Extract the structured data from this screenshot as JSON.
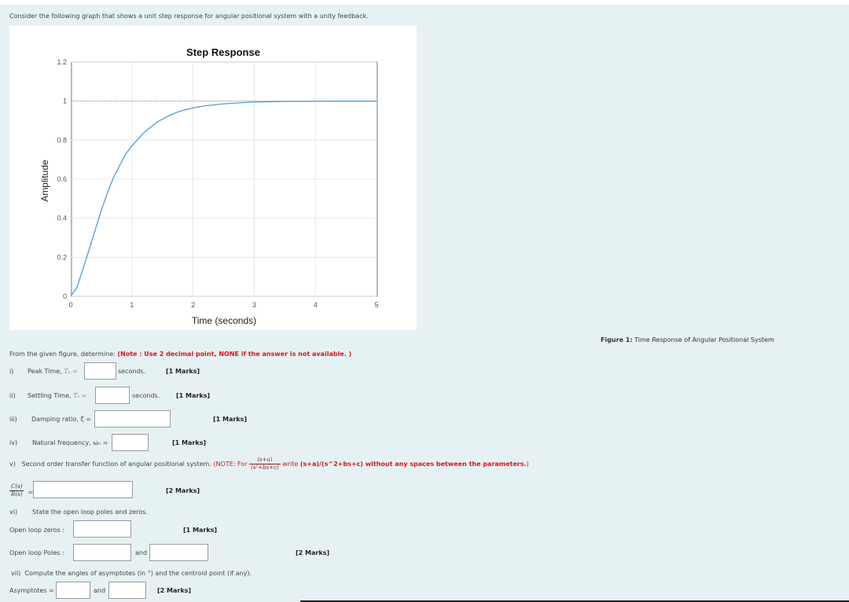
{
  "intro_text": "Consider the following graph that shows a unit step response for angular positional system with a unity feedback.",
  "chart_data": {
    "type": "line",
    "title": "Step Response",
    "xlabel": "Time (seconds)",
    "ylabel": "Amplitude",
    "xlim": [
      0,
      5
    ],
    "ylim": [
      0,
      1.2
    ],
    "x_ticks": [
      "0",
      "1",
      "2",
      "3",
      "4",
      "5"
    ],
    "y_ticks": [
      "0",
      "0.2",
      "0.4",
      "0.6",
      "0.8",
      "1",
      "1.2"
    ],
    "grid": true,
    "steady_state": 1,
    "series": [
      {
        "color": "#4f9bd9",
        "x": [
          0,
          0.1,
          0.2,
          0.3,
          0.4,
          0.5,
          0.6,
          0.7,
          0.8,
          0.9,
          1.0,
          1.2,
          1.4,
          1.6,
          1.8,
          2.0,
          2.2,
          2.5,
          2.8,
          3.0,
          3.5,
          4.0,
          4.5,
          5.0
        ],
        "y": [
          0,
          0.045,
          0.14,
          0.24,
          0.34,
          0.44,
          0.53,
          0.61,
          0.67,
          0.73,
          0.77,
          0.84,
          0.89,
          0.925,
          0.95,
          0.965,
          0.976,
          0.986,
          0.992,
          0.995,
          0.998,
          0.999,
          1.0,
          1.0
        ]
      }
    ]
  },
  "figure_caption": {
    "label": "Figure 1:",
    "text": "Time Response of Angular Positional System"
  },
  "instructions": {
    "text": "From the given figure, determine:",
    "note": "(Note : Use 2 decimal point, NONE if the answer is not available. )"
  },
  "questions": {
    "q1": {
      "num": "i)",
      "label": "Peak Time,",
      "symbol": "Tₚ =",
      "unit": "seconds.",
      "marks": "[1 Marks]"
    },
    "q2": {
      "num": "ii)",
      "label": "Settling Time,",
      "symbol": "Tₛ =",
      "unit": "seconds.",
      "marks": "[1 Marks]"
    },
    "q3": {
      "num": "iii)",
      "label": "Damping ratio, ζ =",
      "marks": "[1 Marks]"
    },
    "q4": {
      "num": "iv)",
      "label": "Natural frequency, ωₙ =",
      "marks": "[1 Marks]"
    },
    "q5": {
      "num": "v)",
      "label": "Second order transfer function of angular positional system.",
      "note_prefix": "(NOTE: For",
      "frac_num": "(s+a)",
      "frac_den": "(s²+bs+c)",
      "note_mid": "write",
      "note_bold": "(s+a)/(s^2+bs+c) without any spaces between the parameters.",
      "note_suffix": ")",
      "tf_num": "C(s)",
      "tf_den": "R(s)",
      "equals": "=",
      "marks": "[2 Marks]"
    },
    "q6": {
      "num": "vi)",
      "label": "State the open loop poles and zeros.",
      "zeros_label": "Open loop zeros :",
      "zeros_marks": "[1 Marks]",
      "poles_label": "Open loop Poles :",
      "and": "and",
      "poles_marks": "[2 Marks]"
    },
    "q7": {
      "num": "vii)",
      "label": "Compute the angles of asymptotes (in °) and the centroid point (if any).",
      "asym_label": "Asymptotes =",
      "and": "and",
      "marks": "[2 Marks]"
    }
  }
}
